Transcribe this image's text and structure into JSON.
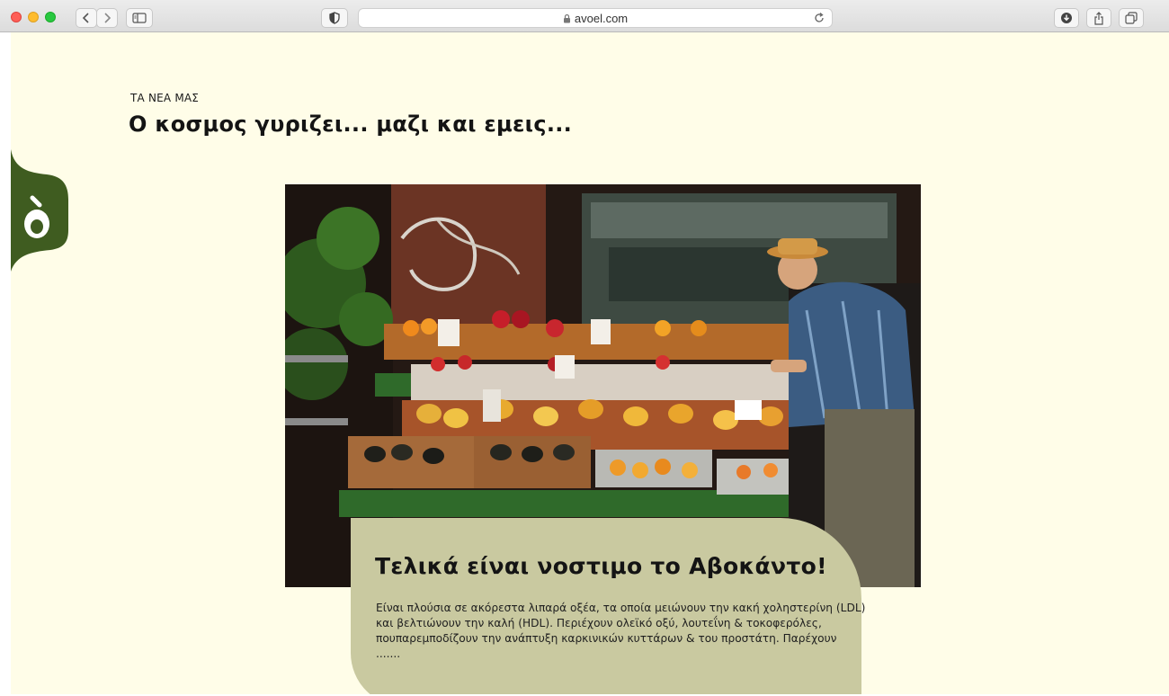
{
  "browser": {
    "url": "avoel.com",
    "colors": {
      "red": "#fe5f57",
      "yellow": "#febc2e",
      "green": "#28c840"
    },
    "icons": [
      "back-icon",
      "forward-icon",
      "sidebar-icon",
      "shield-icon",
      "lock-icon",
      "reload-icon",
      "download-icon",
      "share-icon",
      "tabs-icon"
    ]
  },
  "page": {
    "eyebrow": "ΤΑ ΝΕΑ ΜΑΣ",
    "heading": "Ο κοσμος γυριζει... μαζι και εμεις...",
    "colors": {
      "background": "#fffde8",
      "brand_green": "#3f5c20",
      "card": "#c9c9a0"
    }
  },
  "article": {
    "title": "Τελικά είναι νοστιμο το Αβοκάντο!",
    "text_lines": [
      "Είναι πλούσια σε ακόρεστα λιπαρά οξέα, τα οποία μειώνουν την κακή χοληστερίνη (LDL)",
      "και βελτιώνουν την καλή (HDL). Περιέχουν ολεϊκό οξύ, λουτεΐνη & τοκοφερόλες,",
      "πουπαρεμποδίζουν την ανάπτυξη καρκινικών κυττάρων & του προστάτη. Παρέχουν",
      "......."
    ],
    "image": "fruit-market-photo"
  }
}
